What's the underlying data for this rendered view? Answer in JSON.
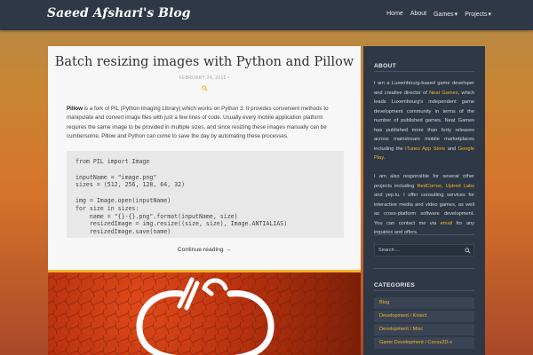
{
  "header": {
    "brand": "Saeed Afshari's Blog",
    "nav": [
      {
        "label": "Home",
        "active": true,
        "dropdown": false
      },
      {
        "label": "About",
        "active": false,
        "dropdown": false
      },
      {
        "label": "Games",
        "active": false,
        "dropdown": true
      },
      {
        "label": "Projects",
        "active": false,
        "dropdown": true
      }
    ]
  },
  "post": {
    "title": "Batch resizing images with Python and Pillow",
    "date": "FEBRUARY 24, 2016",
    "date_separator": "•",
    "intro_bold": "Pillow",
    "intro_rest": " is a fork of PIL (Python Imaging Library) which works on Python 3. It provides convenient methods to manipulate and convert image files with just a few lines of code. Usually every mobile application platform requires the same image to be provided in multiple sizes, and since resizing these images manually can be cumbersome, Pillow and Python can come to save the day by automating these processes.",
    "code": "from PIL import Image\n\ninputName = \"image.png\"\nsizes = (512, 256, 128, 64, 32)\n\nimg = Image.open(inputName)\nfor size in sizes:\n    name = \"{}-{}.png\".format(inputName, size)\n    resizedImage = img.resize((size, size), Image.ANTIALIAS)\n    resizedImage.save(name)",
    "continue_label": "Continue reading →"
  },
  "sidebar": {
    "about_heading": "ABOUT",
    "about_p1": [
      {
        "text": "I am a Luxembourg-based game developer and creative director of ",
        "link": false
      },
      {
        "text": "Neat Games",
        "link": true
      },
      {
        "text": ", which leads Luxembourg's independent game development community in terms of the number of published games. Neat Games has published more than forty releases across mainstream mobile marketplaces including the ",
        "link": false
      },
      {
        "text": "iTunes App Store",
        "link": true
      },
      {
        "text": " and ",
        "link": false
      },
      {
        "text": "Google Play",
        "link": true
      },
      {
        "text": ".",
        "link": false
      }
    ],
    "about_p2": [
      {
        "text": "I am also responsible for several other projects including ",
        "link": false
      },
      {
        "text": "RedCorner",
        "link": true
      },
      {
        "text": ", ",
        "link": false
      },
      {
        "text": "Uptred Labs",
        "link": true
      },
      {
        "text": " and yep.lu. I offer consulting services for interactive media and video games, as well as cross-platform software development. You can contact me via ",
        "link": false
      },
      {
        "text": "email",
        "link": true
      },
      {
        "text": " for any inquiries and offers.",
        "link": false
      }
    ],
    "search_placeholder": "Search ...",
    "categories_heading": "CATEGORIES",
    "categories": [
      "Blog",
      "Development / Kinect",
      "Development / Misc",
      "Game Development / Cocos2D-x"
    ]
  },
  "colors": {
    "accent": "#f0b52c",
    "topbar": "#2f3846",
    "sidebar": "#2f3846"
  }
}
